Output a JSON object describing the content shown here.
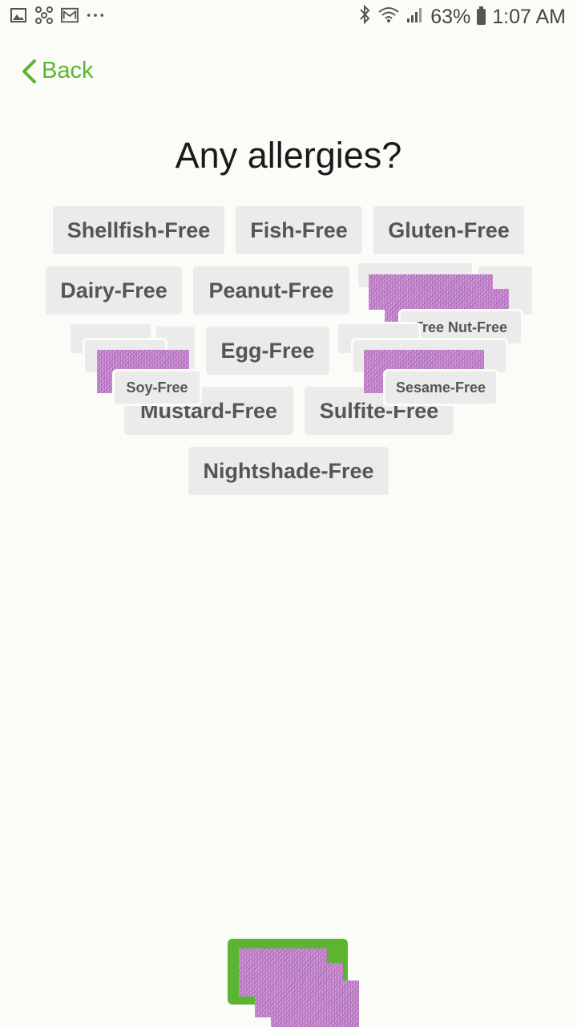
{
  "status": {
    "battery": "63%",
    "time": "1:07 AM"
  },
  "nav": {
    "back_label": "Back"
  },
  "title": "Any allergies?",
  "options": [
    "Shellfish-Free",
    "Fish-Free",
    "Gluten-Free",
    "Dairy-Free",
    "Peanut-Free",
    "Tree Nut-Free",
    "Egg-Free",
    "Soy-Free",
    "Sesame-Free",
    "Mustard-Free",
    "Sulfite-Free",
    "Nightshade-Free"
  ],
  "colors": {
    "accent": "#5cb531",
    "chip_bg": "#ebebeb",
    "chip_text": "#555555"
  }
}
